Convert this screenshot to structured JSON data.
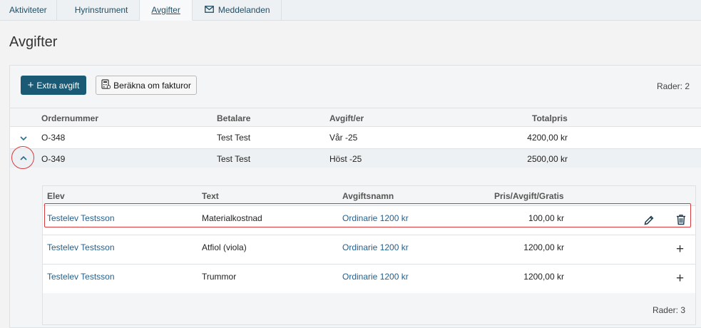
{
  "tabs": [
    {
      "label": "Aktiviteter"
    },
    {
      "label": "Hyrinstrument"
    },
    {
      "label": "Avgifter"
    },
    {
      "label": "Meddelanden"
    }
  ],
  "page": {
    "title": "Avgifter"
  },
  "toolbar": {
    "extra_fee": "Extra avgift",
    "recalc": "Beräkna om fakturor",
    "rows_count": "Rader: 2"
  },
  "orders": {
    "headers": {
      "order_number": "Ordernummer",
      "payer": "Betalare",
      "fees": "Avgift/er",
      "total": "Totalpris"
    },
    "rows": [
      {
        "order_number": "O-348",
        "payer": "Test Test",
        "fees": "Vår -25",
        "total": "4200,00 kr"
      },
      {
        "order_number": "O-349",
        "payer": "Test Test",
        "fees": "Höst -25",
        "total": "2500,00 kr"
      }
    ]
  },
  "details": {
    "headers": {
      "student": "Elev",
      "text": "Text",
      "fee_name": "Avgiftsnamn",
      "price": "Pris/Avgift/Gratis"
    },
    "rows": [
      {
        "student": "Testelev Testsson",
        "text": "Materialkostnad",
        "fee_name": "Ordinarie 1200 kr",
        "price": "100,00 kr"
      },
      {
        "student": "Testelev Testsson",
        "text": "Atfiol (viola)",
        "fee_name": "Ordinarie 1200 kr",
        "price": "1200,00 kr"
      },
      {
        "student": "Testelev Testsson",
        "text": "Trummor",
        "fee_name": "Ordinarie 1200 kr",
        "price": "1200,00 kr"
      }
    ],
    "rows_count": "Rader: 3"
  },
  "colors": {
    "primary": "#1a5a74",
    "link": "#245f8c",
    "highlight": "#d73b3b"
  },
  "icons": [
    "envelope-icon",
    "plus-icon",
    "calculator-icon",
    "chevron-down-icon",
    "chevron-up-icon",
    "pencil-icon",
    "trash-icon"
  ]
}
